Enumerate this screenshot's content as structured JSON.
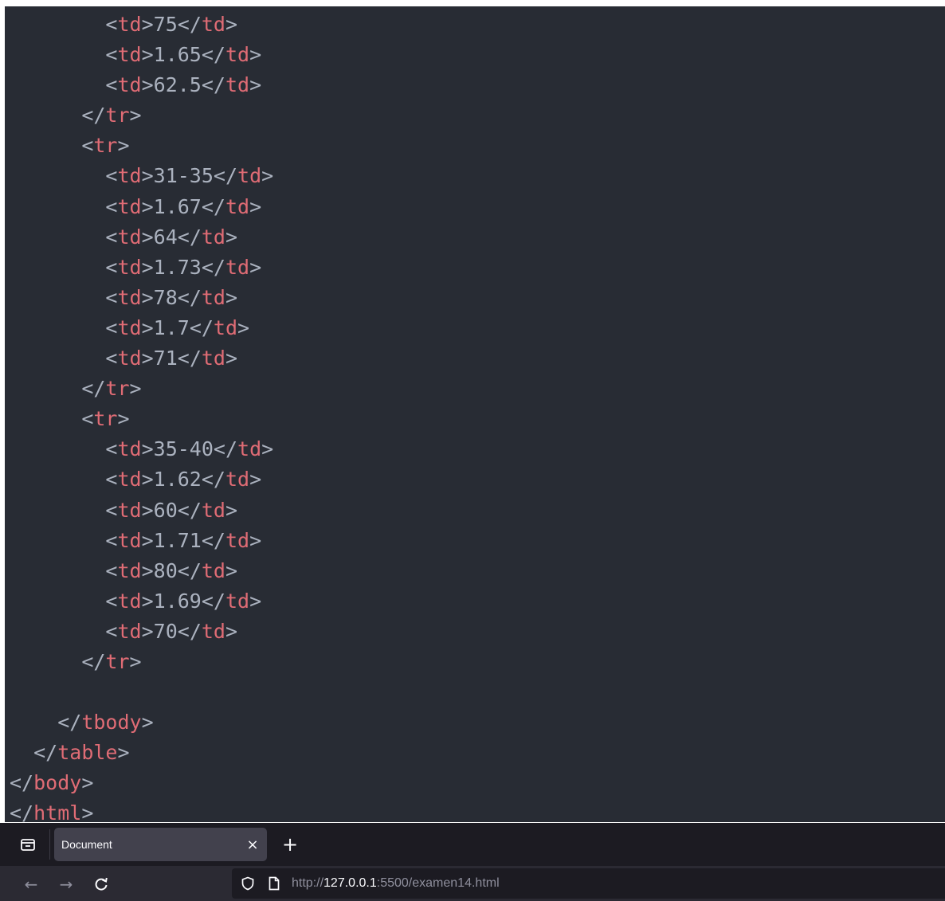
{
  "editor": {
    "lines": [
      {
        "indent": "        ",
        "open": "td",
        "text": "75",
        "close": "td"
      },
      {
        "indent": "        ",
        "open": "td",
        "text": "1.65",
        "close": "td"
      },
      {
        "indent": "        ",
        "open": "td",
        "text": "62.5",
        "close": "td"
      },
      {
        "indent": "      ",
        "close": "tr"
      },
      {
        "indent": "      ",
        "open": "tr"
      },
      {
        "indent": "        ",
        "open": "td",
        "text": "31-35",
        "close": "td"
      },
      {
        "indent": "        ",
        "open": "td",
        "text": "1.67",
        "close": "td"
      },
      {
        "indent": "        ",
        "open": "td",
        "text": "64",
        "close": "td"
      },
      {
        "indent": "        ",
        "open": "td",
        "text": "1.73",
        "close": "td"
      },
      {
        "indent": "        ",
        "open": "td",
        "text": "78",
        "close": "td"
      },
      {
        "indent": "        ",
        "open": "td",
        "text": "1.7",
        "close": "td"
      },
      {
        "indent": "        ",
        "open": "td",
        "text": "71",
        "close": "td"
      },
      {
        "indent": "      ",
        "close": "tr"
      },
      {
        "indent": "      ",
        "open": "tr"
      },
      {
        "indent": "        ",
        "open": "td",
        "text": "35-40",
        "close": "td"
      },
      {
        "indent": "        ",
        "open": "td",
        "text": "1.62",
        "close": "td"
      },
      {
        "indent": "        ",
        "open": "td",
        "text": "60",
        "close": "td"
      },
      {
        "indent": "        ",
        "open": "td",
        "text": "1.71",
        "close": "td"
      },
      {
        "indent": "        ",
        "open": "td",
        "text": "80",
        "close": "td"
      },
      {
        "indent": "        ",
        "open": "td",
        "text": "1.69",
        "close": "td"
      },
      {
        "indent": "        ",
        "open": "td",
        "text": "70",
        "close": "td"
      },
      {
        "indent": "      ",
        "close": "tr"
      },
      {
        "indent": ""
      },
      {
        "indent": "    ",
        "close": "tbody"
      },
      {
        "indent": "  ",
        "close": "table"
      },
      {
        "indent": "",
        "close": "body"
      },
      {
        "indent": "",
        "close": "html"
      }
    ]
  },
  "browser": {
    "tab_overview_icon": "tab-overview-icon",
    "tab": {
      "title": "Document",
      "close_label": "×"
    },
    "new_tab_label": "+",
    "nav": {
      "back_label": "←",
      "forward_label": "→",
      "reload_label": "C"
    },
    "url": {
      "scheme": "http://",
      "host": "127.0.0.1",
      "rest": ":5500/examen14.html"
    }
  },
  "colors": {
    "editor_bg": "#282c34",
    "tag": "#e06c75",
    "punctuation": "#abb2bf",
    "browser_bg": "#1c1b22",
    "tab_bg": "#42414d"
  }
}
